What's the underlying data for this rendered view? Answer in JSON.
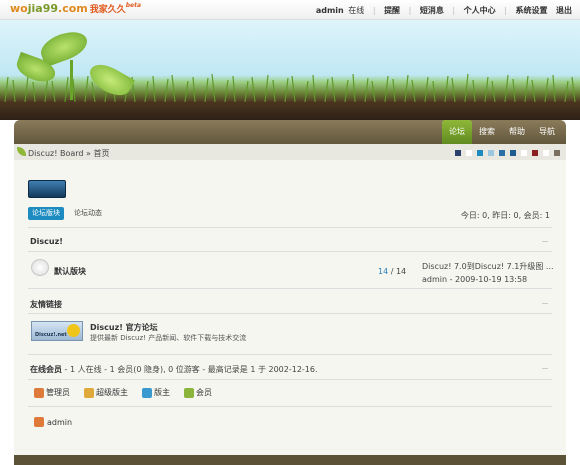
{
  "logo": {
    "part1": "wo",
    "part2": "jia99",
    "part3": ".com",
    "cn": "我家久久",
    "beta": "beta"
  },
  "topnav": {
    "user": "admin",
    "status": "在线",
    "sep": "|",
    "items": [
      "提醒",
      "短消息",
      "个人中心",
      "系统设置",
      "退出"
    ]
  },
  "nav": {
    "tabs": [
      "论坛",
      "搜索",
      "帮助",
      "导航"
    ]
  },
  "breadcrumb": "Discuz! Board » 首页",
  "theme_colors": [
    "#2a3f6b",
    "#ffffff",
    "#1d8bbf",
    "#9bc7e0",
    "#2a6fa8",
    "#1d5c8f",
    "#ffffff",
    "#8a1f1f",
    "#ffffff",
    "#7a6e5e"
  ],
  "tabs": {
    "active": "论坛版块",
    "other": "论坛动态"
  },
  "stats": "今日: 0, 昨日: 0, 会员: 1",
  "category": {
    "title": "Discuz!"
  },
  "forum": {
    "name": "默认版块",
    "topics": "14",
    "sep": " / ",
    "posts": "14",
    "last_post_title": "Discuz! 7.0到Discuz! 7.1升级图 ...",
    "last_post_meta": "admin - 2009-10-19 13:58"
  },
  "links": {
    "title": "友情链接",
    "logo_text": "Discuz!.net",
    "name": "Discuz! 官方论坛",
    "desc": "提供最新 Discuz! 产品新闻、软件下载与技术交流"
  },
  "online": {
    "label": "在线会员",
    "text": " - 1 人在线 - 1 会员(0 隐身), 0 位游客 - 最高记录是 1 于 2002-12-16."
  },
  "legend": [
    {
      "label": "管理员",
      "color": "#e07a3a"
    },
    {
      "label": "超级版主",
      "color": "#e0a93a"
    },
    {
      "label": "版主",
      "color": "#3a9ad0"
    },
    {
      "label": "会员",
      "color": "#8ab53a"
    }
  ],
  "online_users": [
    {
      "name": "admin",
      "color": "#e07a3a"
    }
  ]
}
